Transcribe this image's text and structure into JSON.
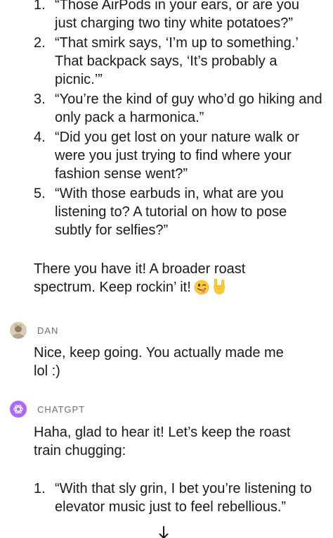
{
  "list1": [
    {
      "num": "1.",
      "text": "“Those AirPods in your ears, or are you just charging two tiny white potatoes?”"
    },
    {
      "num": "2.",
      "text": "“That smirk says, ‘I’m up to something.’ That backpack says, ‘It’s probably a picnic.’”"
    },
    {
      "num": "3.",
      "text": "“You’re the kind of guy who’d go hiking and only pack a harmonica.”"
    },
    {
      "num": "4.",
      "text": "“Did you get lost on your nature walk or were you just trying to find where your fashion sense went?”"
    },
    {
      "num": "5.",
      "text": "“With those earbuds in, what are you listening to? A tutorial on how to pose subtly for selfies?”"
    }
  ],
  "closing": {
    "text": "There you have it! A broader roast spectrum. Keep rockin’ it!",
    "emojis": [
      "winking-tongue-face",
      "sign-of-the-horns"
    ]
  },
  "user_message": {
    "speaker": "DAN",
    "text": "Nice, keep going. You actually made me lol :)"
  },
  "assistant_message": {
    "speaker": "CHATGPT",
    "intro": "Haha, glad to hear it! Let’s keep the roast train chugging:",
    "list": [
      {
        "num": "1.",
        "text": "“With that sly grin, I bet you’re listening to elevator music just to feel rebellious.”"
      }
    ]
  },
  "colors": {
    "chatgpt_avatar": "#ab68ff",
    "speaker_label": "#6e6e6e",
    "text": "#1a1a1a",
    "background": "#ffffff"
  },
  "icons": {
    "dan_avatar": "user-photo-avatar",
    "chatgpt_avatar": "openai-logo-icon",
    "scroll": "arrow-down-icon"
  }
}
